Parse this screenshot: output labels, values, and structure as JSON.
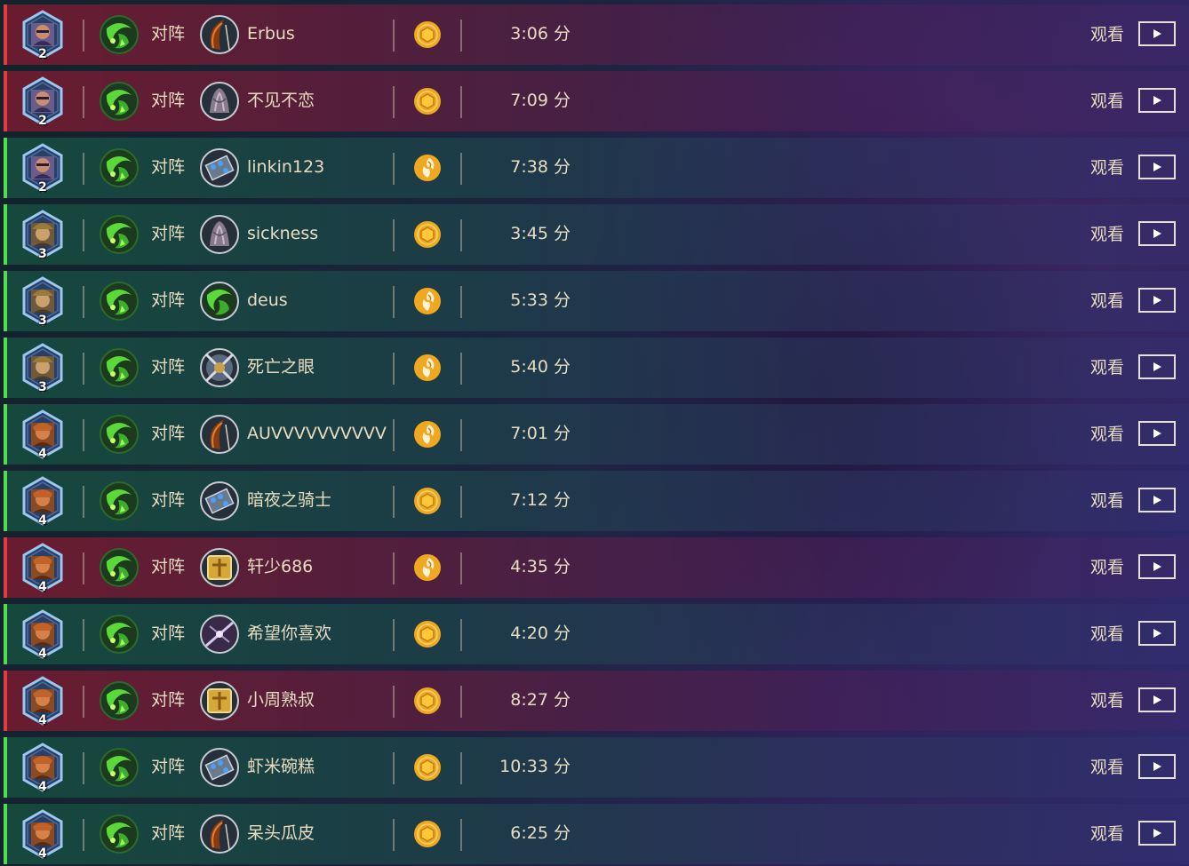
{
  "labels": {
    "vs": "对阵",
    "watch": "观看",
    "minute_unit": "分"
  },
  "colors": {
    "win_stripe": "#4ee04a",
    "loss_stripe": "#e53a3e",
    "text": "#e8dcc0",
    "mode_icon": "#f0a820"
  },
  "player_class_icon": "green-fel-class-icon",
  "games": [
    {
      "result": "loss",
      "hero_icon": "hero-portrait-warlock-icon",
      "rank": "2",
      "opponent_class_icon": "opponent-class-hunter-icon",
      "opponent": "Erbus",
      "mode_icon": "coin-icon",
      "duration": "3:06"
    },
    {
      "result": "loss",
      "hero_icon": "hero-portrait-warlock-icon",
      "rank": "2",
      "opponent_class_icon": "opponent-class-priest-icon",
      "opponent": "不见不恋",
      "mode_icon": "coin-icon",
      "duration": "7:09"
    },
    {
      "result": "win",
      "hero_icon": "hero-portrait-warlock-icon",
      "rank": "2",
      "opponent_class_icon": "opponent-class-mage-icon",
      "opponent": "linkin123",
      "mode_icon": "first-turn-icon",
      "duration": "7:38"
    },
    {
      "result": "win",
      "hero_icon": "hero-portrait-rogue-icon",
      "rank": "3",
      "opponent_class_icon": "opponent-class-priest-icon",
      "opponent": "sickness",
      "mode_icon": "coin-icon",
      "duration": "3:45"
    },
    {
      "result": "win",
      "hero_icon": "hero-portrait-rogue-icon",
      "rank": "3",
      "opponent_class_icon": "opponent-class-warlock-icon",
      "opponent": "deus",
      "mode_icon": "first-turn-icon",
      "duration": "5:33"
    },
    {
      "result": "win",
      "hero_icon": "hero-portrait-rogue-icon",
      "rank": "3",
      "opponent_class_icon": "opponent-class-warrior-icon",
      "opponent": "死亡之眼",
      "mode_icon": "first-turn-icon",
      "duration": "5:40"
    },
    {
      "result": "win",
      "hero_icon": "hero-portrait-shaman-icon",
      "rank": "4",
      "opponent_class_icon": "opponent-class-hunter-icon",
      "opponent": "AUVVVVVVVVVV",
      "mode_icon": "first-turn-icon",
      "duration": "7:01"
    },
    {
      "result": "win",
      "hero_icon": "hero-portrait-shaman-icon",
      "rank": "4",
      "opponent_class_icon": "opponent-class-mage-icon",
      "opponent": "暗夜之骑士",
      "mode_icon": "coin-icon",
      "duration": "7:12"
    },
    {
      "result": "loss",
      "hero_icon": "hero-portrait-shaman-icon",
      "rank": "4",
      "opponent_class_icon": "opponent-class-paladin-icon",
      "opponent": "轩少686",
      "mode_icon": "first-turn-icon",
      "duration": "4:35"
    },
    {
      "result": "win",
      "hero_icon": "hero-portrait-shaman-icon",
      "rank": "4",
      "opponent_class_icon": "opponent-class-rogue-icon",
      "opponent": "希望你喜欢",
      "mode_icon": "coin-icon",
      "duration": "4:20"
    },
    {
      "result": "loss",
      "hero_icon": "hero-portrait-shaman-icon",
      "rank": "4",
      "opponent_class_icon": "opponent-class-paladin-icon",
      "opponent": "小周熟叔",
      "mode_icon": "coin-icon",
      "duration": "8:27"
    },
    {
      "result": "win",
      "hero_icon": "hero-portrait-shaman-icon",
      "rank": "4",
      "opponent_class_icon": "opponent-class-mage-icon",
      "opponent": "虾米碗糕",
      "mode_icon": "coin-icon",
      "duration": "10:33"
    },
    {
      "result": "win",
      "hero_icon": "hero-portrait-shaman-icon",
      "rank": "4",
      "opponent_class_icon": "opponent-class-hunter-icon",
      "opponent": "呆头瓜皮",
      "mode_icon": "coin-icon",
      "duration": "6:25"
    }
  ]
}
